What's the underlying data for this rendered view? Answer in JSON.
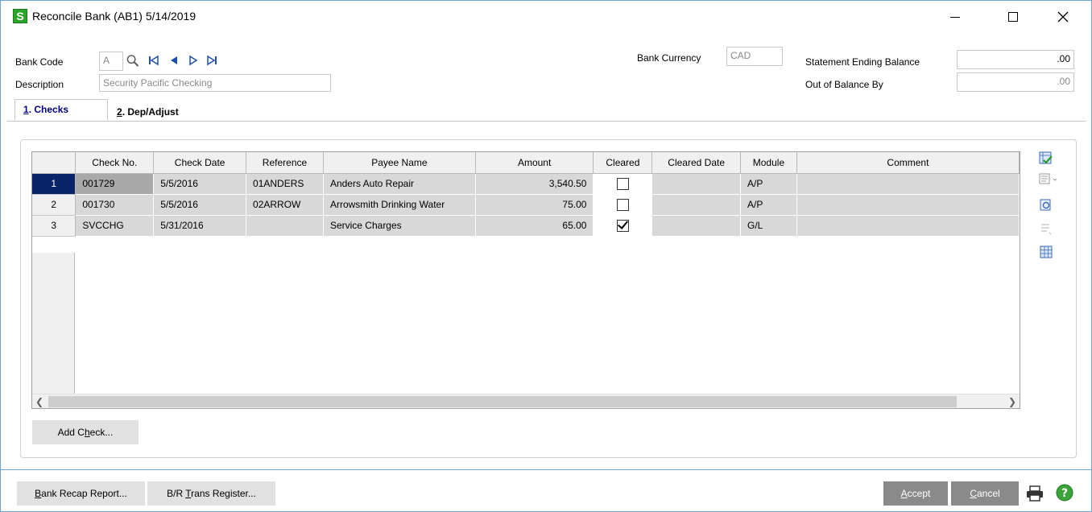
{
  "window": {
    "title": "Reconcile Bank (AB1) 5/14/2019",
    "logo_letter": "S"
  },
  "header": {
    "bank_code_label": "Bank Code",
    "bank_code_value": "A",
    "description_label": "Description",
    "description_value": "Security Pacific Checking",
    "bank_currency_label": "Bank Currency",
    "bank_currency_value": "CAD",
    "statement_ending_balance_label": "Statement Ending Balance",
    "statement_ending_balance_value": ".00",
    "out_of_balance_label": "Out of Balance By",
    "out_of_balance_value": ".00"
  },
  "tabs": [
    {
      "key": "1",
      "label": ". Checks"
    },
    {
      "key": "2",
      "label": ". Dep/Adjust"
    }
  ],
  "grid": {
    "columns": [
      "Check No.",
      "Check Date",
      "Reference",
      "Payee Name",
      "Amount",
      "Cleared",
      "Cleared Date",
      "Module",
      "Comment"
    ],
    "rows": [
      {
        "num": "1",
        "check_no": "001729",
        "check_date": "5/5/2016",
        "reference": "01ANDERS",
        "payee": "Anders Auto Repair",
        "amount": "3,540.50",
        "cleared": false,
        "cleared_date": "",
        "module": "A/P",
        "comment": ""
      },
      {
        "num": "2",
        "check_no": "001730",
        "check_date": "5/5/2016",
        "reference": "02ARROW",
        "payee": "Arrowsmith Drinking Water",
        "amount": "75.00",
        "cleared": false,
        "cleared_date": "",
        "module": "A/P",
        "comment": ""
      },
      {
        "num": "3",
        "check_no": "SVCCHG",
        "check_date": "5/31/2016",
        "reference": "",
        "payee": "Service Charges",
        "amount": "65.00",
        "cleared": true,
        "cleared_date": "",
        "module": "G/L",
        "comment": ""
      }
    ]
  },
  "buttons": {
    "add_check_pre": "Add C",
    "add_check_ul": "h",
    "add_check_post": "eck...",
    "bank_recap_ul": "B",
    "bank_recap_post": "ank Recap Report...",
    "br_trans_pre": "B/R ",
    "br_trans_ul": "T",
    "br_trans_post": "rans Register...",
    "accept_ul": "A",
    "accept_post": "ccept",
    "cancel_ul": "C",
    "cancel_post": "ancel"
  },
  "icons": {
    "lookup": "magnifier-icon",
    "first": "first-record-icon",
    "prev": "previous-record-icon",
    "next": "next-record-icon",
    "last": "last-record-icon",
    "print": "printer-icon",
    "help": "help-icon"
  },
  "colors": {
    "accent": "#0a246a",
    "logo": "#2aa52a",
    "window_border": "#6fa0d8",
    "dark_button": "#8a8a8a"
  }
}
